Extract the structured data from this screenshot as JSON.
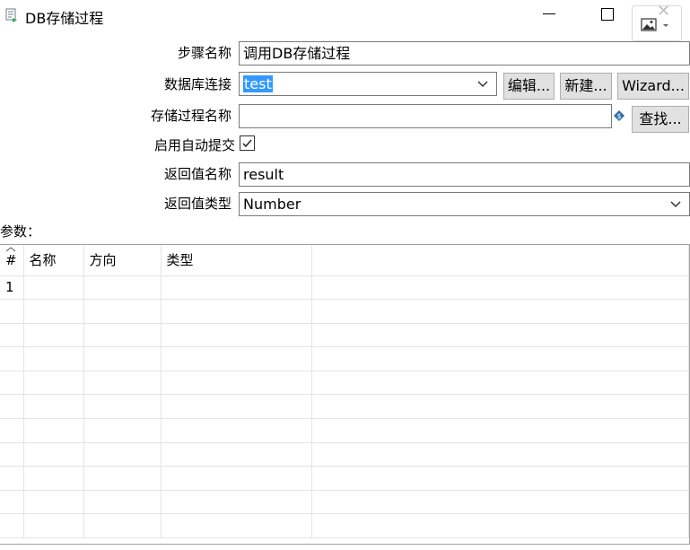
{
  "window": {
    "title": "DB存储过程",
    "icon": "db-procedure-icon"
  },
  "form": {
    "step_name_label": "步骤名称",
    "step_name_value": "调用DB存储过程",
    "connection_label": "数据库连接",
    "connection_value": "test",
    "edit_button": "编辑...",
    "new_button": "新建...",
    "wizard_button": "Wizard...",
    "proc_name_label": "存储过程名称",
    "proc_name_value": "",
    "find_button": "查找...",
    "autocommit_label": "启用自动提交",
    "autocommit_checked": true,
    "return_name_label": "返回值名称",
    "return_name_value": "result",
    "return_type_label": "返回值类型",
    "return_type_value": "Number"
  },
  "params": {
    "label": "参数：",
    "columns": [
      "#",
      "名称",
      "方向",
      "类型"
    ],
    "rows": [
      {
        "idx": "1",
        "name": "",
        "direction": "",
        "type": ""
      }
    ]
  },
  "colors": {
    "selection": "#3399ff",
    "button_bg": "#e1e1e1",
    "border": "#7a7a7a"
  }
}
